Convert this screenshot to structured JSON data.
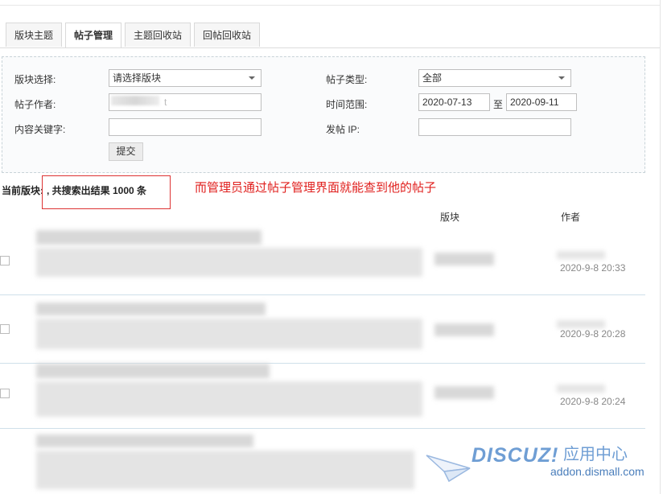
{
  "tabs": [
    {
      "label": "版块主题"
    },
    {
      "label": "帖子管理"
    },
    {
      "label": "主题回收站"
    },
    {
      "label": "回帖回收站"
    }
  ],
  "search": {
    "forum_label": "版块选择:",
    "forum_value": "请选择版块",
    "type_label": "帖子类型:",
    "type_value": "全部",
    "author_label": "帖子作者:",
    "author_value": "t",
    "time_label": "时间范围:",
    "time_from": "2020-07-13",
    "time_sep": "至",
    "time_to": "2020-09-11",
    "keyword_label": "内容关键字:",
    "keyword_value": "",
    "ip_label": "发帖 IP:",
    "ip_value": "",
    "submit_label": "提交"
  },
  "results": {
    "current_forum": "当前版块:",
    "summary": ", 共搜索出结果 1000 条",
    "annotation": "而管理员通过帖子管理界面就能查到他的帖子"
  },
  "columns": {
    "forum": "版块",
    "author": "作者"
  },
  "rows": [
    {
      "date": "2020-9-8 20:33"
    },
    {
      "date": "2020-9-8 20:28"
    },
    {
      "date": "2020-9-8 20:24"
    }
  ],
  "watermark": {
    "brand": "DISCUZ!",
    "center": "应用中心",
    "url": "addon.dismall.com"
  }
}
